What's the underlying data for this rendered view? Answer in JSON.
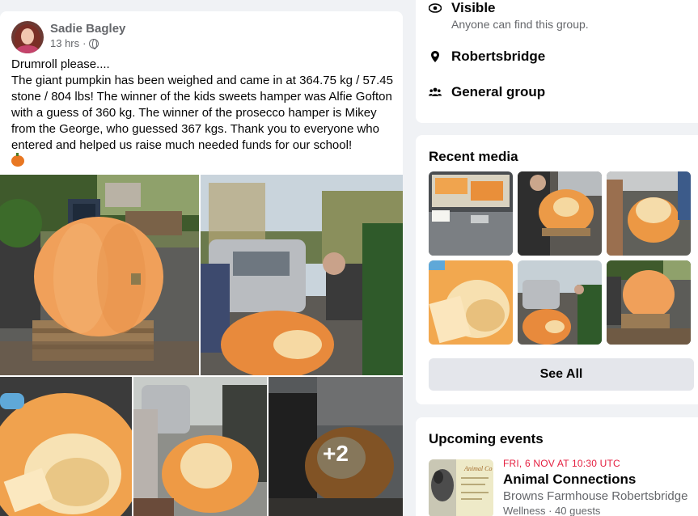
{
  "post": {
    "author": "Sadie Bagley",
    "time": "13 hrs",
    "separator": "·",
    "text": "Drumroll please....\nThe giant pumpkin has been weighed and came in at 364.75 kg / 57.45 stone / 804 lbs! The winner of the kids sweets hamper was Alfie Gofton with a guess of 360 kg. The winner of the prosecco hamper is Mikey from the George, who guessed 367 kgs. Thank you to everyone who entered and helped us raise much needed funds for our school!",
    "more_photos": "+2"
  },
  "about": {
    "visible_title": "Visible",
    "visible_sub": "Anyone can find this group.",
    "location": "Robertsbridge",
    "group_type": "General group"
  },
  "recent_media": {
    "title": "Recent media",
    "see_all": "See All"
  },
  "events": {
    "title": "Upcoming events",
    "items": [
      {
        "date": "FRI, 6 NOV AT 10:30 UTC",
        "name": "Animal Connections",
        "location": "Browns Farmhouse Robertsbridge",
        "meta": "Wellness · 40 guests",
        "thumb_text": "Animal Co"
      }
    ]
  },
  "colors": {
    "page_bg": "#f0f2f5",
    "event_date": "#e41e3f",
    "pumpkin": "#f0a05a"
  }
}
